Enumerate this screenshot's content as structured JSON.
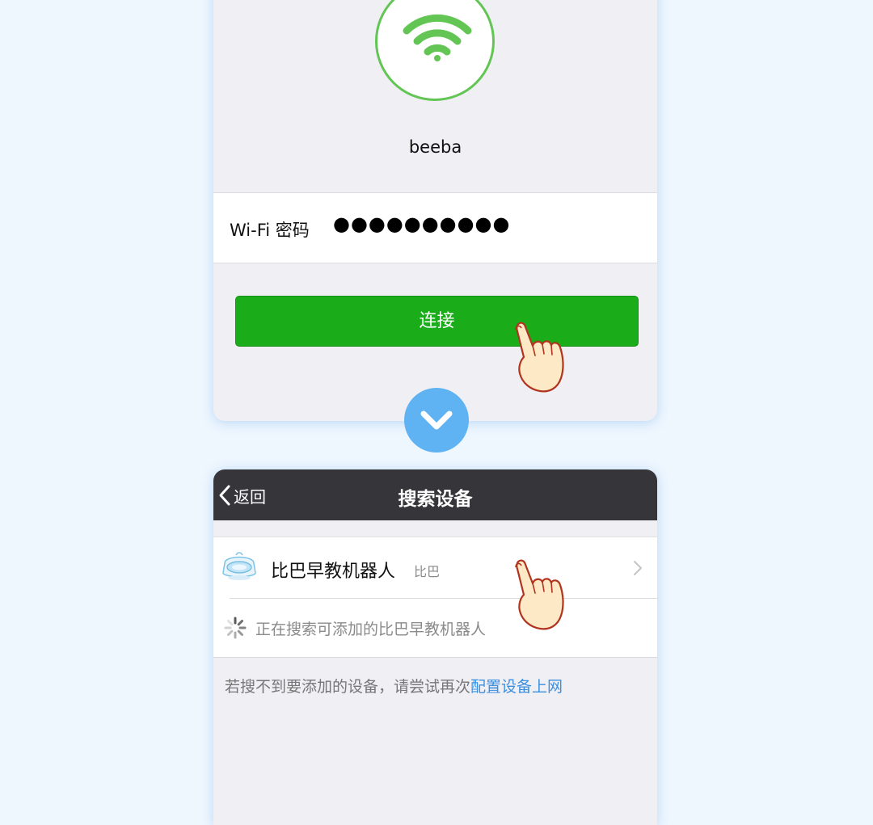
{
  "top_screen": {
    "wifi_icon": "wifi-icon",
    "ssid": "beeba",
    "password_label": "Wi-Fi 密码",
    "password_value": "●●●●●●●●●●",
    "connect_label": "连接"
  },
  "transition_icon": "chevron-down-icon",
  "bottom_screen": {
    "back_label": "返回",
    "title": "搜索设备",
    "device": {
      "icon": "robot-device-icon",
      "name": "比巴早教机器人",
      "brand": "比巴"
    },
    "searching_text": "正在搜索可添加的比巴早教机器人",
    "hint_text": "若搜不到要添加的设备，请尝试再次",
    "hint_link": "配置设备上网"
  },
  "pointer_icons": [
    "hand-pointer-icon",
    "hand-pointer-icon"
  ],
  "colors": {
    "background": "#eef6fe",
    "wifi_green": "#62c554",
    "button_green": "#1aad19",
    "arrow_blue": "#5fb3f3",
    "navbar": "#36353a",
    "link_blue": "#3b8fe0"
  }
}
